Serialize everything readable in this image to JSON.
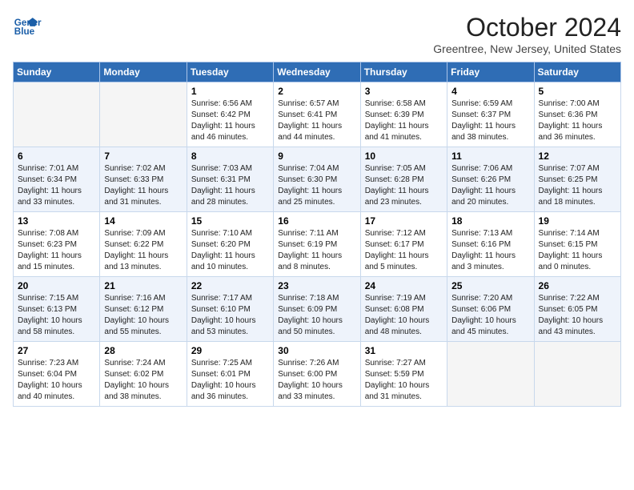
{
  "logo": {
    "line1": "General",
    "line2": "Blue"
  },
  "title": "October 2024",
  "location": "Greentree, New Jersey, United States",
  "weekdays": [
    "Sunday",
    "Monday",
    "Tuesday",
    "Wednesday",
    "Thursday",
    "Friday",
    "Saturday"
  ],
  "weeks": [
    [
      {
        "day": "",
        "info": ""
      },
      {
        "day": "",
        "info": ""
      },
      {
        "day": "1",
        "info": "Sunrise: 6:56 AM\nSunset: 6:42 PM\nDaylight: 11 hours and 46 minutes."
      },
      {
        "day": "2",
        "info": "Sunrise: 6:57 AM\nSunset: 6:41 PM\nDaylight: 11 hours and 44 minutes."
      },
      {
        "day": "3",
        "info": "Sunrise: 6:58 AM\nSunset: 6:39 PM\nDaylight: 11 hours and 41 minutes."
      },
      {
        "day": "4",
        "info": "Sunrise: 6:59 AM\nSunset: 6:37 PM\nDaylight: 11 hours and 38 minutes."
      },
      {
        "day": "5",
        "info": "Sunrise: 7:00 AM\nSunset: 6:36 PM\nDaylight: 11 hours and 36 minutes."
      }
    ],
    [
      {
        "day": "6",
        "info": "Sunrise: 7:01 AM\nSunset: 6:34 PM\nDaylight: 11 hours and 33 minutes."
      },
      {
        "day": "7",
        "info": "Sunrise: 7:02 AM\nSunset: 6:33 PM\nDaylight: 11 hours and 31 minutes."
      },
      {
        "day": "8",
        "info": "Sunrise: 7:03 AM\nSunset: 6:31 PM\nDaylight: 11 hours and 28 minutes."
      },
      {
        "day": "9",
        "info": "Sunrise: 7:04 AM\nSunset: 6:30 PM\nDaylight: 11 hours and 25 minutes."
      },
      {
        "day": "10",
        "info": "Sunrise: 7:05 AM\nSunset: 6:28 PM\nDaylight: 11 hours and 23 minutes."
      },
      {
        "day": "11",
        "info": "Sunrise: 7:06 AM\nSunset: 6:26 PM\nDaylight: 11 hours and 20 minutes."
      },
      {
        "day": "12",
        "info": "Sunrise: 7:07 AM\nSunset: 6:25 PM\nDaylight: 11 hours and 18 minutes."
      }
    ],
    [
      {
        "day": "13",
        "info": "Sunrise: 7:08 AM\nSunset: 6:23 PM\nDaylight: 11 hours and 15 minutes."
      },
      {
        "day": "14",
        "info": "Sunrise: 7:09 AM\nSunset: 6:22 PM\nDaylight: 11 hours and 13 minutes."
      },
      {
        "day": "15",
        "info": "Sunrise: 7:10 AM\nSunset: 6:20 PM\nDaylight: 11 hours and 10 minutes."
      },
      {
        "day": "16",
        "info": "Sunrise: 7:11 AM\nSunset: 6:19 PM\nDaylight: 11 hours and 8 minutes."
      },
      {
        "day": "17",
        "info": "Sunrise: 7:12 AM\nSunset: 6:17 PM\nDaylight: 11 hours and 5 minutes."
      },
      {
        "day": "18",
        "info": "Sunrise: 7:13 AM\nSunset: 6:16 PM\nDaylight: 11 hours and 3 minutes."
      },
      {
        "day": "19",
        "info": "Sunrise: 7:14 AM\nSunset: 6:15 PM\nDaylight: 11 hours and 0 minutes."
      }
    ],
    [
      {
        "day": "20",
        "info": "Sunrise: 7:15 AM\nSunset: 6:13 PM\nDaylight: 10 hours and 58 minutes."
      },
      {
        "day": "21",
        "info": "Sunrise: 7:16 AM\nSunset: 6:12 PM\nDaylight: 10 hours and 55 minutes."
      },
      {
        "day": "22",
        "info": "Sunrise: 7:17 AM\nSunset: 6:10 PM\nDaylight: 10 hours and 53 minutes."
      },
      {
        "day": "23",
        "info": "Sunrise: 7:18 AM\nSunset: 6:09 PM\nDaylight: 10 hours and 50 minutes."
      },
      {
        "day": "24",
        "info": "Sunrise: 7:19 AM\nSunset: 6:08 PM\nDaylight: 10 hours and 48 minutes."
      },
      {
        "day": "25",
        "info": "Sunrise: 7:20 AM\nSunset: 6:06 PM\nDaylight: 10 hours and 45 minutes."
      },
      {
        "day": "26",
        "info": "Sunrise: 7:22 AM\nSunset: 6:05 PM\nDaylight: 10 hours and 43 minutes."
      }
    ],
    [
      {
        "day": "27",
        "info": "Sunrise: 7:23 AM\nSunset: 6:04 PM\nDaylight: 10 hours and 40 minutes."
      },
      {
        "day": "28",
        "info": "Sunrise: 7:24 AM\nSunset: 6:02 PM\nDaylight: 10 hours and 38 minutes."
      },
      {
        "day": "29",
        "info": "Sunrise: 7:25 AM\nSunset: 6:01 PM\nDaylight: 10 hours and 36 minutes."
      },
      {
        "day": "30",
        "info": "Sunrise: 7:26 AM\nSunset: 6:00 PM\nDaylight: 10 hours and 33 minutes."
      },
      {
        "day": "31",
        "info": "Sunrise: 7:27 AM\nSunset: 5:59 PM\nDaylight: 10 hours and 31 minutes."
      },
      {
        "day": "",
        "info": ""
      },
      {
        "day": "",
        "info": ""
      }
    ]
  ]
}
